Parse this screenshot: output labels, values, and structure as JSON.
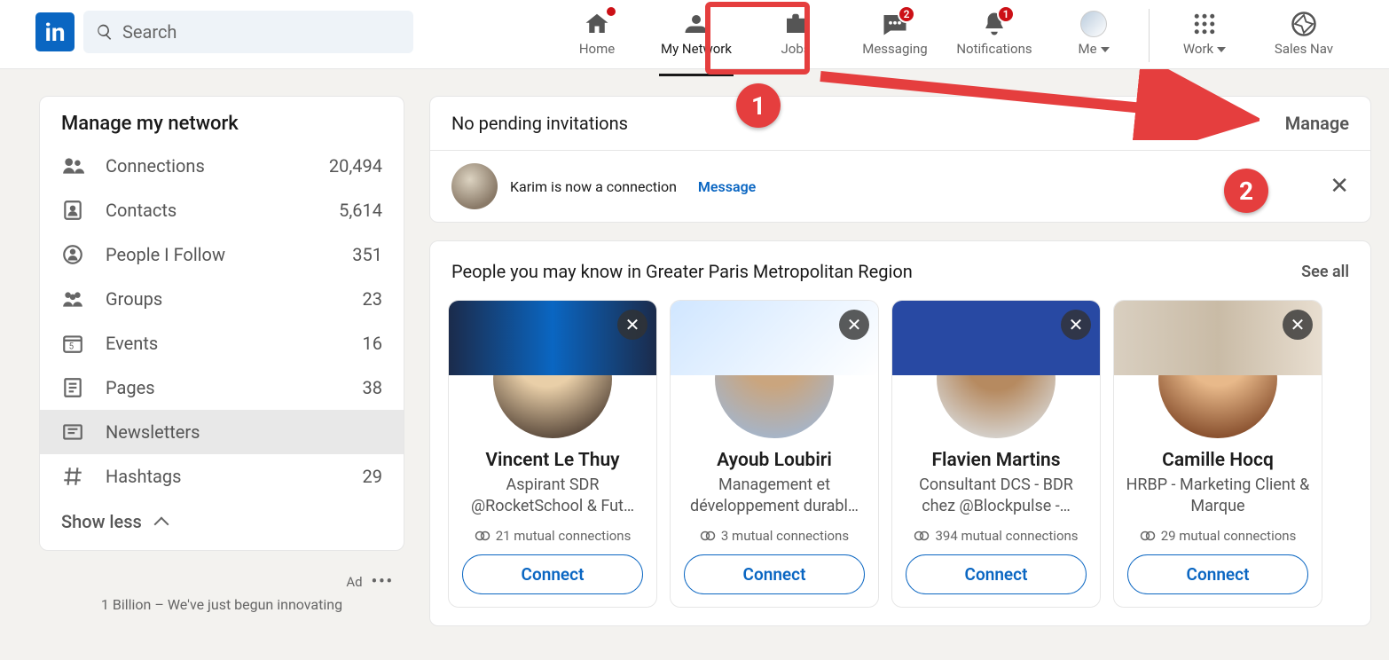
{
  "annotations": {
    "step1": "1",
    "step2": "2"
  },
  "nav": {
    "search_placeholder": "Search",
    "home": "Home",
    "my_network": "My Network",
    "jobs": "Jobs",
    "messaging": "Messaging",
    "notifications": "Notifications",
    "me": "Me",
    "work": "Work",
    "sales_nav": "Sales Nav",
    "badges": {
      "messaging": "2",
      "notifications": "1"
    }
  },
  "sidebar": {
    "title": "Manage my network",
    "items": [
      {
        "label": "Connections",
        "count": "20,494"
      },
      {
        "label": "Contacts",
        "count": "5,614"
      },
      {
        "label": "People I Follow",
        "count": "351"
      },
      {
        "label": "Groups",
        "count": "23"
      },
      {
        "label": "Events",
        "count": "16"
      },
      {
        "label": "Pages",
        "count": "38"
      },
      {
        "label": "Newsletters",
        "count": ""
      },
      {
        "label": "Hashtags",
        "count": "29"
      }
    ],
    "show_less": "Show less"
  },
  "ad": {
    "tag": "Ad",
    "text": "1 Billion – We've just begun innovating"
  },
  "invitations": {
    "title": "No pending invitations",
    "manage": "Manage",
    "row_text": "Karim is now a connection",
    "message": "Message"
  },
  "pymk": {
    "title": "People you may know in Greater Paris Metropolitan Region",
    "see_all": "See all",
    "people": [
      {
        "name": "Vincent Le Thuy",
        "sub": "Aspirant SDR @RocketSchool & Fut…",
        "mutual": "21 mutual connections",
        "connect": "Connect"
      },
      {
        "name": "Ayoub Loubiri",
        "sub": "Management et développement durabl…",
        "mutual": "3 mutual connections",
        "connect": "Connect"
      },
      {
        "name": "Flavien Martins",
        "sub": "Consultant DCS - BDR chez @Blockpulse -…",
        "mutual": "394 mutual connections",
        "connect": "Connect"
      },
      {
        "name": "Camille Hocq",
        "sub": "HRBP - Marketing Client & Marque",
        "mutual": "29 mutual connections",
        "connect": "Connect"
      }
    ]
  }
}
